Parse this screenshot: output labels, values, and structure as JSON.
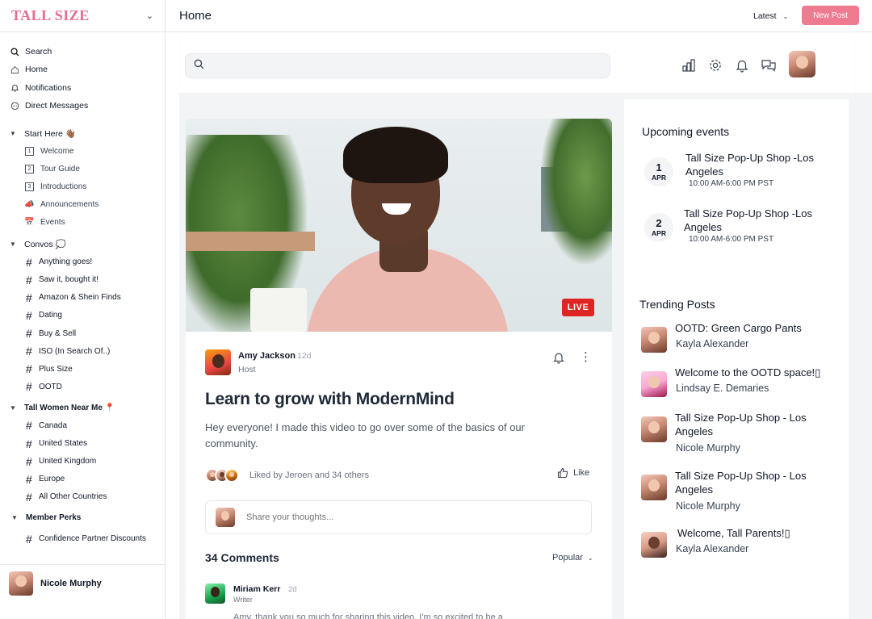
{
  "brand": {
    "name": "TALL SIZE"
  },
  "nav": {
    "primary": [
      {
        "label": "Search",
        "icon": "search-icon"
      },
      {
        "label": "Home",
        "icon": "home-icon"
      },
      {
        "label": "Notifications",
        "icon": "bell-icon"
      },
      {
        "label": "Direct Messages",
        "icon": "chat-icon"
      }
    ],
    "start_here": {
      "label": "Start Here 👋🏾",
      "items": [
        {
          "label": "Welcome",
          "icon": "1"
        },
        {
          "label": "Tour Guide",
          "icon": "2"
        },
        {
          "label": "Introductions",
          "icon": "3"
        },
        {
          "label": "Announcements",
          "icon": "📣"
        },
        {
          "label": "Events",
          "icon": "📅"
        }
      ]
    },
    "convos": {
      "label": "Convos 💭",
      "items": [
        "Anything goes!",
        "Saw it, bought it!",
        "Amazon & Shein Finds",
        "Dating",
        "Buy & Sell",
        "ISO (In Search Of..)",
        "Plus Size",
        "OOTD"
      ]
    },
    "near_me": {
      "label": "Tall Women Near Me 📍",
      "items": [
        "Canada",
        "United States",
        "United Kingdom",
        "Europe",
        "All Other Countries"
      ]
    },
    "perks": {
      "label": "Member Perks",
      "items": [
        "Confidence Partner Discounts"
      ]
    }
  },
  "current_user": {
    "name": "Nicole Murphy"
  },
  "topbar": {
    "title": "Home",
    "sort": "Latest",
    "new_post": "New Post"
  },
  "search": {
    "placeholder": ""
  },
  "post": {
    "live_label": "LIVE",
    "author": "Amy Jackson",
    "ago": "12d",
    "role": "Host",
    "title": "Learn to grow with ModernMind",
    "body": "Hey everyone! I made this video to go over some of the basics of our community.",
    "liked_by": "Liked by Jeroen and 34 others",
    "like_label": "Like",
    "share_placeholder": "Share your thoughts...",
    "comments_count": "34 Comments",
    "comments_sort": "Popular"
  },
  "comment": {
    "name": "Miriam Kerr",
    "ago": "2d",
    "role": "Writer",
    "text": "Amy, thank you so much for sharing this video. I'm so excited to be a"
  },
  "events": {
    "heading": "Upcoming events",
    "items": [
      {
        "day": "1",
        "month": "APR",
        "title": "Tall Size Pop-Up Shop -Los Angeles",
        "time": "10:00 AM-6:00 PM PST"
      },
      {
        "day": "2",
        "month": "APR",
        "title": "Tall Size Pop-Up Shop -Los Angeles",
        "time": "10:00 AM-6:00 PM PST"
      }
    ]
  },
  "trending": {
    "heading": "Trending Posts",
    "items": [
      {
        "title": "OOTD: Green Cargo Pants",
        "author": "Kayla Alexander"
      },
      {
        "title": "Welcome to the OOTD space!▯",
        "author": "Lindsay E. Demaries"
      },
      {
        "title": "Tall Size Pop-Up Shop - Los Angeles",
        "author": "Nicole Murphy"
      },
      {
        "title": "Tall Size Pop-Up Shop - Los Angeles",
        "author": "Nicole Murphy"
      },
      {
        "title": "Welcome, Tall Parents!▯",
        "author": "Kayla Alexander"
      }
    ]
  },
  "colors": {
    "accent": "#ef7b90",
    "brand": "#e56d8f",
    "live": "#e02424"
  }
}
